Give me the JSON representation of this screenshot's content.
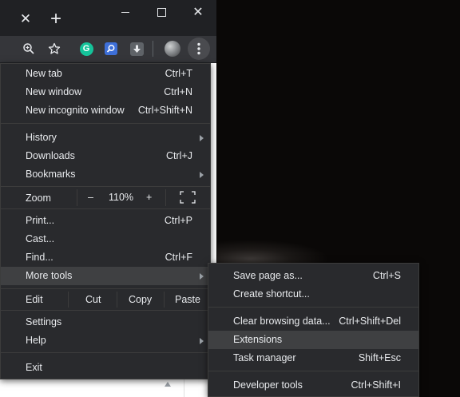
{
  "titlebar": {
    "close_tab_glyph": "✕",
    "new_tab_glyph": "+"
  },
  "window_controls": {
    "minimize": "—",
    "maximize": "☐",
    "close": "✕"
  },
  "toolbar": {
    "icons": [
      "zoom-icon",
      "bookmark-star-icon",
      "grammarly-icon",
      "extension-search-icon",
      "download-extension-icon",
      "profile-avatar",
      "chrome-menu-icon"
    ],
    "grammarly_letter": "G",
    "menu_glyph": "⋮"
  },
  "menu": {
    "new_tab": {
      "label": "New tab",
      "shortcut": "Ctrl+T"
    },
    "new_window": {
      "label": "New window",
      "shortcut": "Ctrl+N"
    },
    "new_incognito": {
      "label": "New incognito window",
      "shortcut": "Ctrl+Shift+N"
    },
    "history": {
      "label": "History"
    },
    "downloads": {
      "label": "Downloads",
      "shortcut": "Ctrl+J"
    },
    "bookmarks": {
      "label": "Bookmarks"
    },
    "zoom": {
      "label": "Zoom",
      "minus": "–",
      "value": "110%",
      "plus": "+"
    },
    "print": {
      "label": "Print...",
      "shortcut": "Ctrl+P"
    },
    "cast": {
      "label": "Cast..."
    },
    "find": {
      "label": "Find...",
      "shortcut": "Ctrl+F"
    },
    "more_tools": {
      "label": "More tools"
    },
    "edit": {
      "label": "Edit",
      "cut": "Cut",
      "copy": "Copy",
      "paste": "Paste"
    },
    "settings": {
      "label": "Settings"
    },
    "help": {
      "label": "Help"
    },
    "exit": {
      "label": "Exit"
    }
  },
  "submenu": {
    "save_page": {
      "label": "Save page as...",
      "shortcut": "Ctrl+S"
    },
    "create_shortcut": {
      "label": "Create shortcut..."
    },
    "clear_browsing": {
      "label": "Clear browsing data...",
      "shortcut": "Ctrl+Shift+Del"
    },
    "extensions": {
      "label": "Extensions"
    },
    "task_manager": {
      "label": "Task manager",
      "shortcut": "Shift+Esc"
    },
    "developer_tools": {
      "label": "Developer tools",
      "shortcut": "Ctrl+Shift+I"
    }
  },
  "colors": {
    "menu_bg": "#292a2d",
    "highlight": "#3f4042",
    "titlebar": "#202124",
    "toolbar": "#35363a",
    "text": "#e8eaed"
  }
}
